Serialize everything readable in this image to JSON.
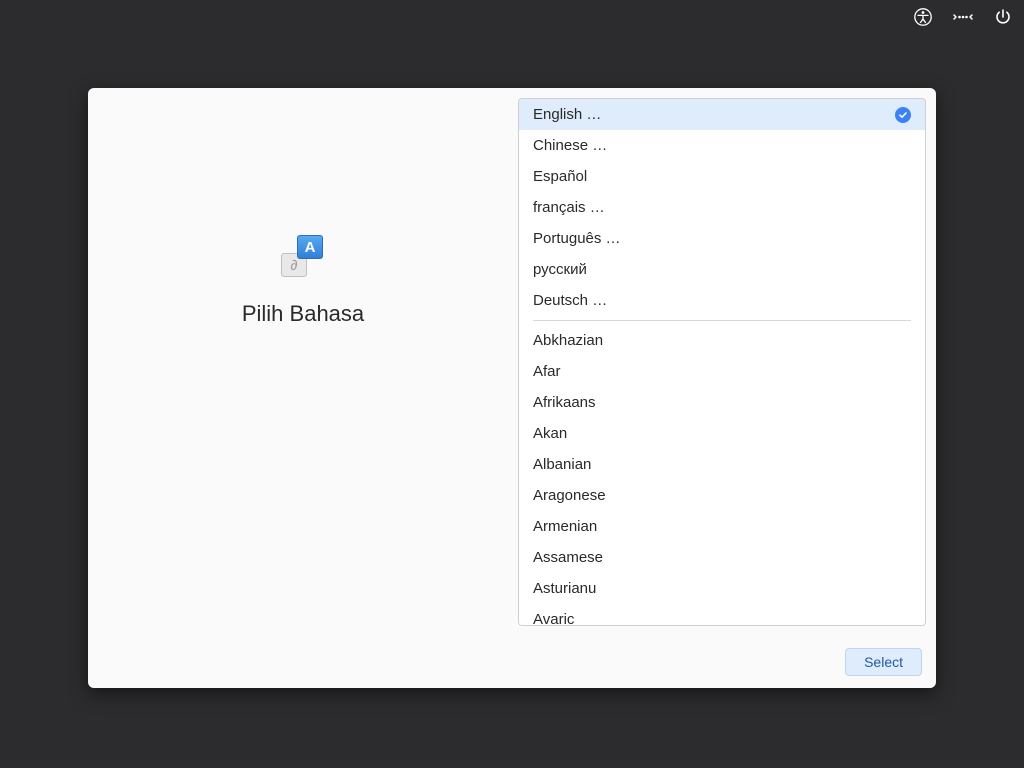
{
  "topbar": {
    "icons": [
      "accessibility-icon",
      "network-icon",
      "power-icon"
    ]
  },
  "left": {
    "title": "Pilih Bahasa",
    "icon_front_letter": "A",
    "icon_back_symbol": "∂"
  },
  "languages": {
    "primary": [
      "English …",
      "Chinese …",
      "Español",
      "français …",
      "Português …",
      "русский",
      "Deutsch …"
    ],
    "secondary": [
      "Abkhazian",
      "Afar",
      "Afrikaans",
      "Akan",
      "Albanian",
      "Aragonese",
      "Armenian",
      "Assamese",
      "Asturianu",
      "Avaric"
    ],
    "selected_index": 0
  },
  "footer": {
    "select_label": "Select"
  }
}
